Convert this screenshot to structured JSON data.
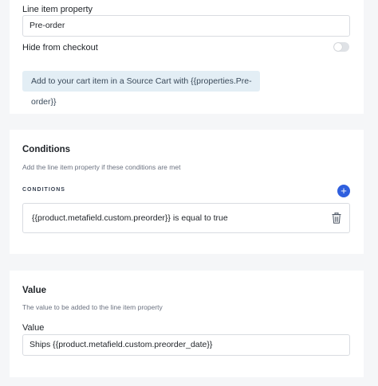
{
  "property_section": {
    "line_item_property_label": "Line item property",
    "line_item_property_value": "Pre-order",
    "hide_from_checkout_label": "Hide from checkout",
    "hide_from_checkout_enabled": false,
    "info_text": "Add to your cart item in a Source Cart with {{properties.Pre-order}}"
  },
  "conditions_section": {
    "title": "Conditions",
    "description": "Add the line item property if these conditions are met",
    "list_label": "CONDITIONS",
    "add_icon": "plus-icon",
    "items": [
      {
        "text": "{{product.metafield.custom.preorder}} is equal to true",
        "delete_icon": "trash-icon"
      }
    ]
  },
  "value_section": {
    "title": "Value",
    "description": "The value to be added to the line item property",
    "value_label": "Value",
    "value": "Ships {{product.metafield.custom.preorder_date}}"
  },
  "colors": {
    "accent": "#2f5fde",
    "info_bg": "#e3eef5",
    "page_bg": "#f5f6f8"
  }
}
